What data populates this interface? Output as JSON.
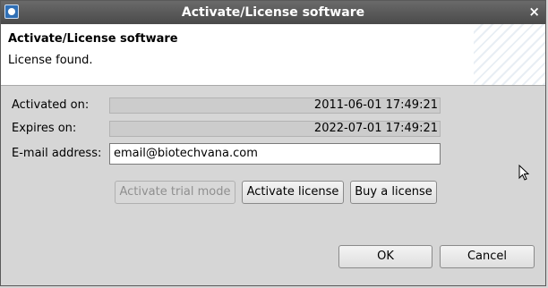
{
  "window": {
    "title": "Activate/License software",
    "close_glyph": "×"
  },
  "banner": {
    "title": "Activate/License software",
    "message": "License found."
  },
  "form": {
    "activated_label": "Activated on:",
    "activated_value": "2011-06-01 17:49:21",
    "expires_label": "Expires on:",
    "expires_value": "2022-07-01 17:49:21",
    "email_label": "E-mail address:",
    "email_value": "email@biotechvana.com"
  },
  "actions": {
    "trial_label": "Activate trial mode",
    "activate_label": "Activate license",
    "buy_label": "Buy a license"
  },
  "footer": {
    "ok_label": "OK",
    "cancel_label": "Cancel"
  },
  "icons": {
    "app": "app-icon",
    "close": "close-icon",
    "cursor": "mouse-pointer-icon"
  }
}
